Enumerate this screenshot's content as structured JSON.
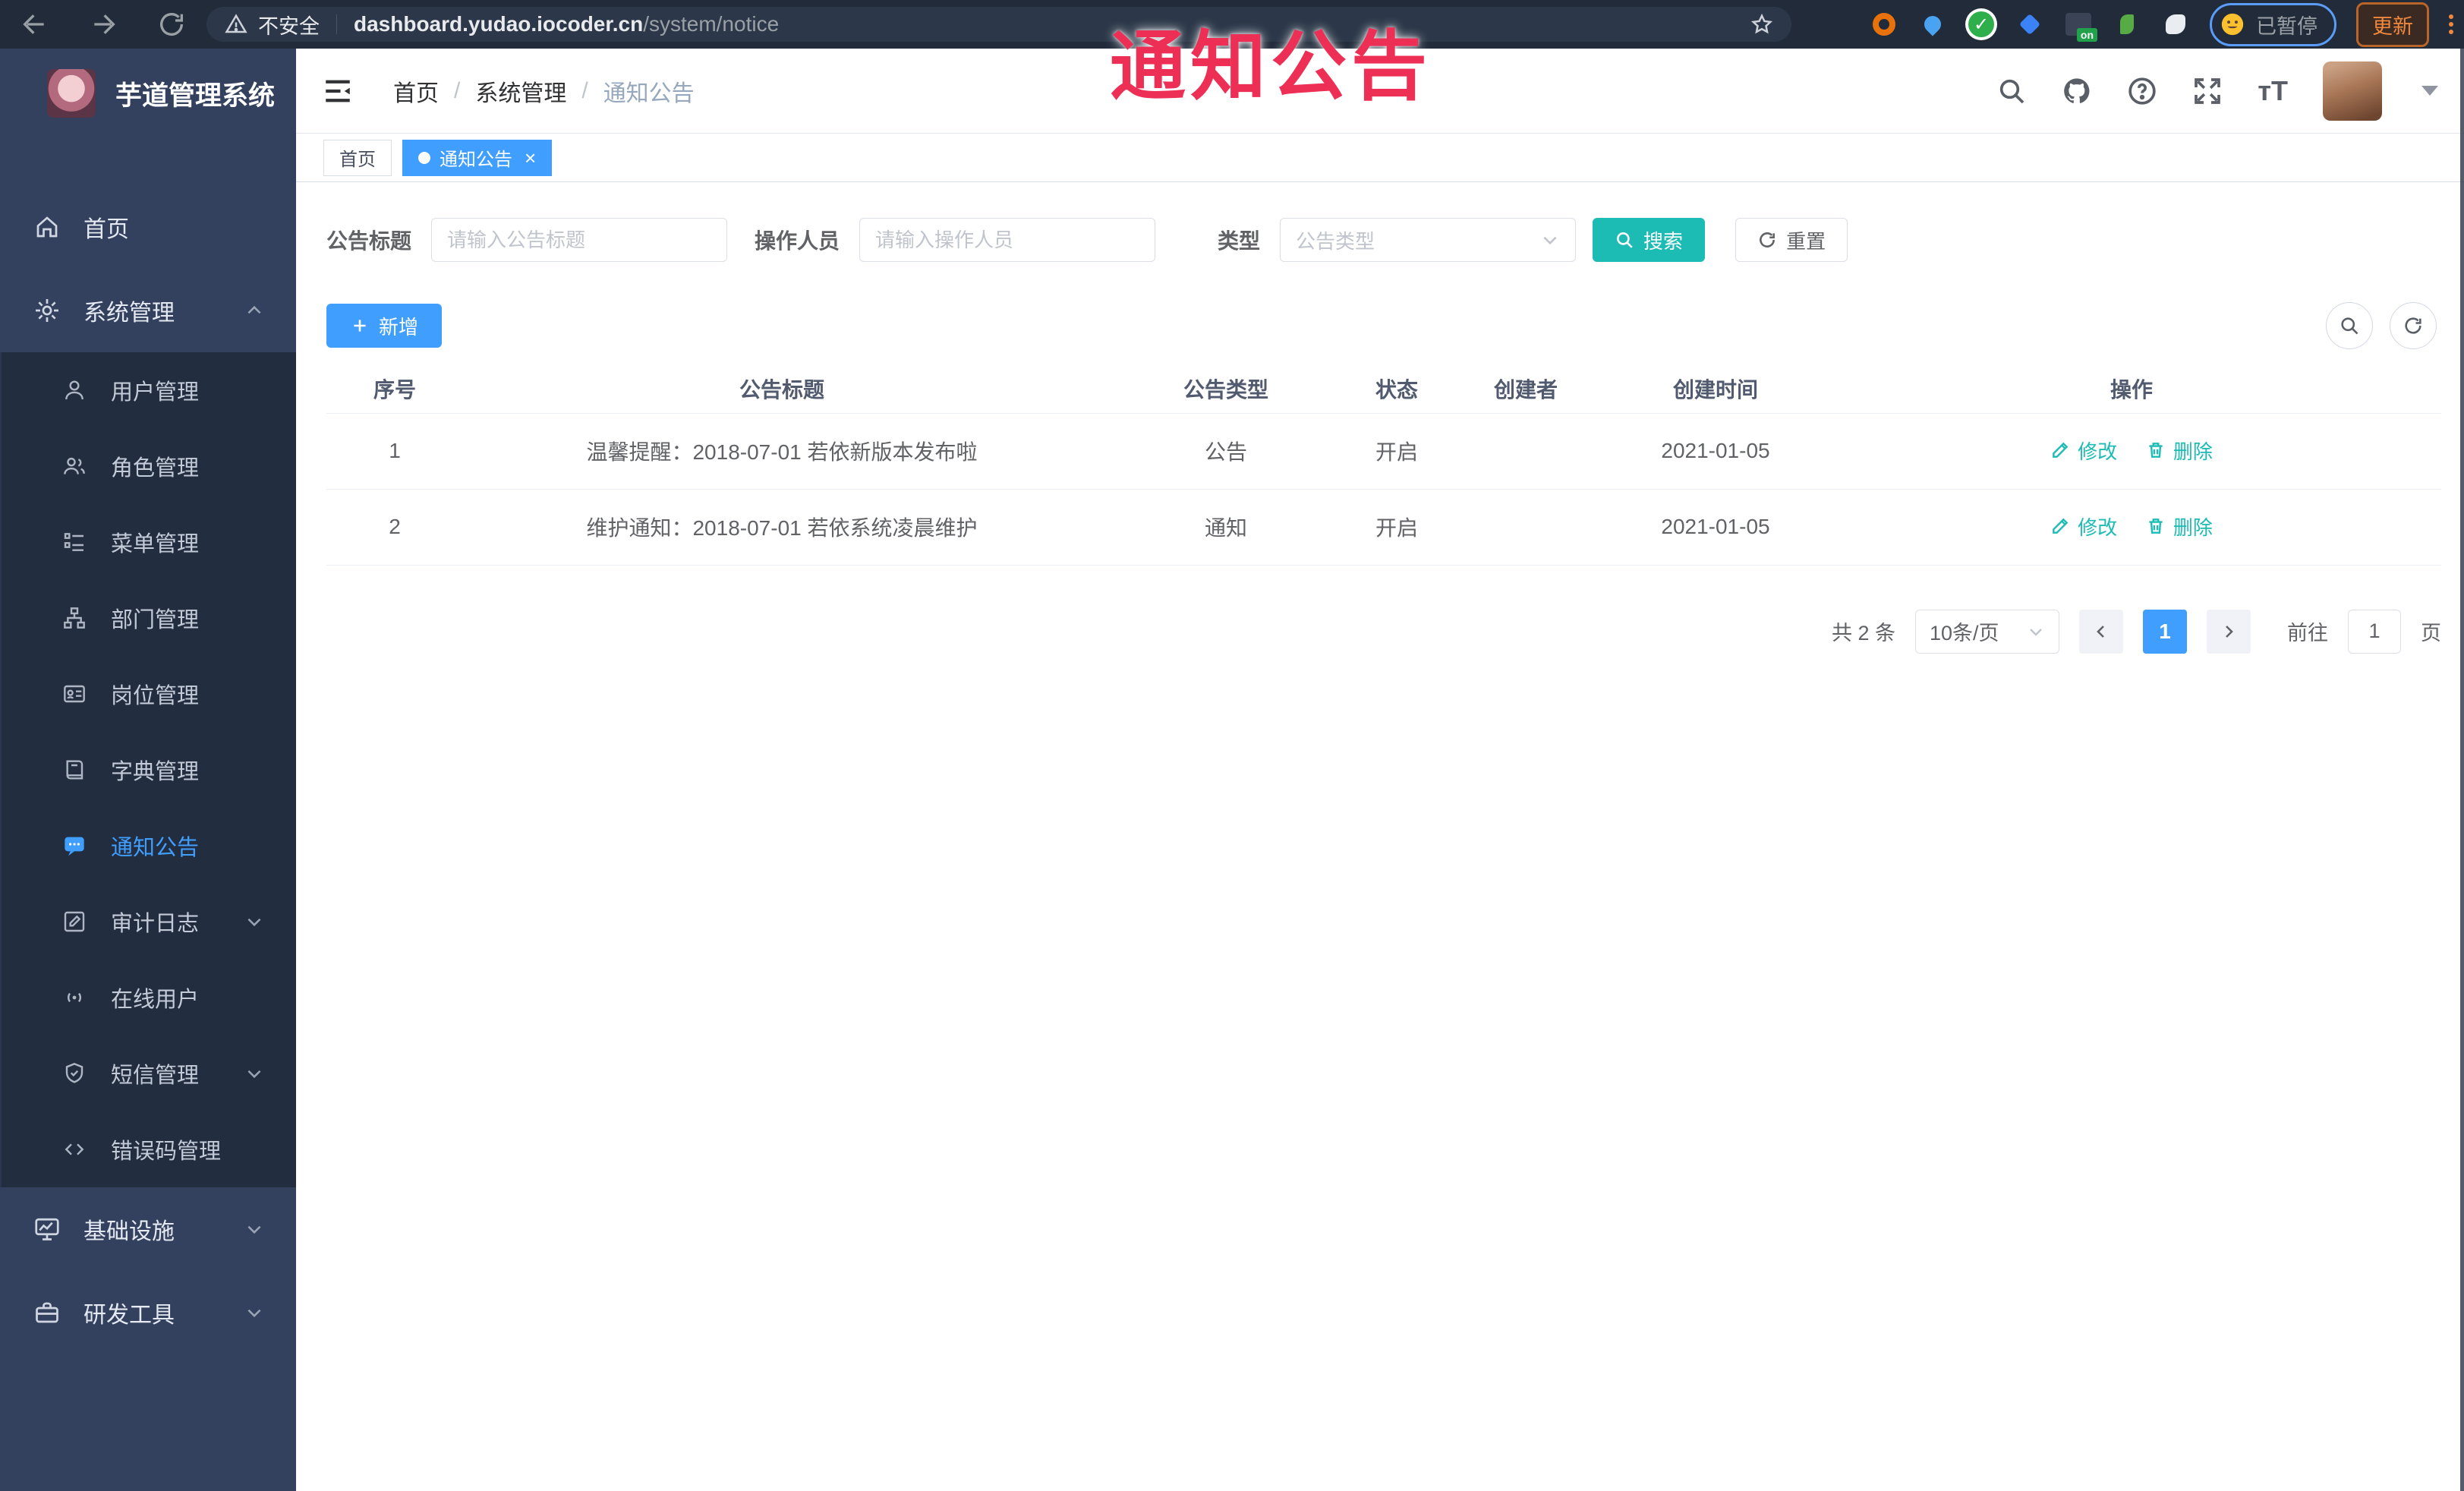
{
  "colors": {
    "accent_blue": "#409eff",
    "accent_teal": "#1cbbb4",
    "overlay_red": "#ee2f55",
    "sidebar_bg": "#33415e",
    "submenu_bg": "#222d40",
    "tag_active": "#409eff"
  },
  "overlay": {
    "title": "通知公告"
  },
  "browser": {
    "security": "不安全",
    "url_host": "dashboard.yudao.iocoder.cn",
    "url_path": "/system/notice",
    "paused_label": "已暂停",
    "update_label": "更新",
    "on_badge": "on"
  },
  "sidebar": {
    "logo_title": "芋道管理系统",
    "items": [
      {
        "label": "首页"
      },
      {
        "label": "系统管理"
      },
      {
        "label": "用户管理"
      },
      {
        "label": "角色管理"
      },
      {
        "label": "菜单管理"
      },
      {
        "label": "部门管理"
      },
      {
        "label": "岗位管理"
      },
      {
        "label": "字典管理"
      },
      {
        "label": "通知公告"
      },
      {
        "label": "审计日志"
      },
      {
        "label": "在线用户"
      },
      {
        "label": "短信管理"
      },
      {
        "label": "错误码管理"
      },
      {
        "label": "基础设施"
      },
      {
        "label": "研发工具"
      }
    ]
  },
  "navbar": {
    "breadcrumb": [
      {
        "label": "首页"
      },
      {
        "label": "系统管理"
      },
      {
        "label": "通知公告"
      }
    ]
  },
  "tags": [
    {
      "label": "首页"
    },
    {
      "label": "通知公告"
    }
  ],
  "search": {
    "title_label": "公告标题",
    "title_placeholder": "请输入公告标题",
    "operator_label": "操作人员",
    "operator_placeholder": "请输入操作人员",
    "type_label": "类型",
    "type_placeholder": "公告类型",
    "search_btn": "搜索",
    "reset_btn": "重置"
  },
  "toolbar": {
    "add_btn": "新增"
  },
  "table": {
    "columns": [
      "序号",
      "公告标题",
      "公告类型",
      "状态",
      "创建者",
      "创建时间",
      "操作"
    ],
    "rows": [
      {
        "index": "1",
        "title": "温馨提醒：2018-07-01 若依新版本发布啦",
        "type": "公告",
        "status": "开启",
        "creator": "",
        "created": "2021-01-05"
      },
      {
        "index": "2",
        "title": "维护通知：2018-07-01 若依系统凌晨维护",
        "type": "通知",
        "status": "开启",
        "creator": "",
        "created": "2021-01-05"
      }
    ],
    "edit_label": "修改",
    "delete_label": "删除"
  },
  "pagination": {
    "total": "共 2 条",
    "page_size": "10条/页",
    "page": "1",
    "goto": "前往",
    "goto_value": "1",
    "unit": "页"
  }
}
